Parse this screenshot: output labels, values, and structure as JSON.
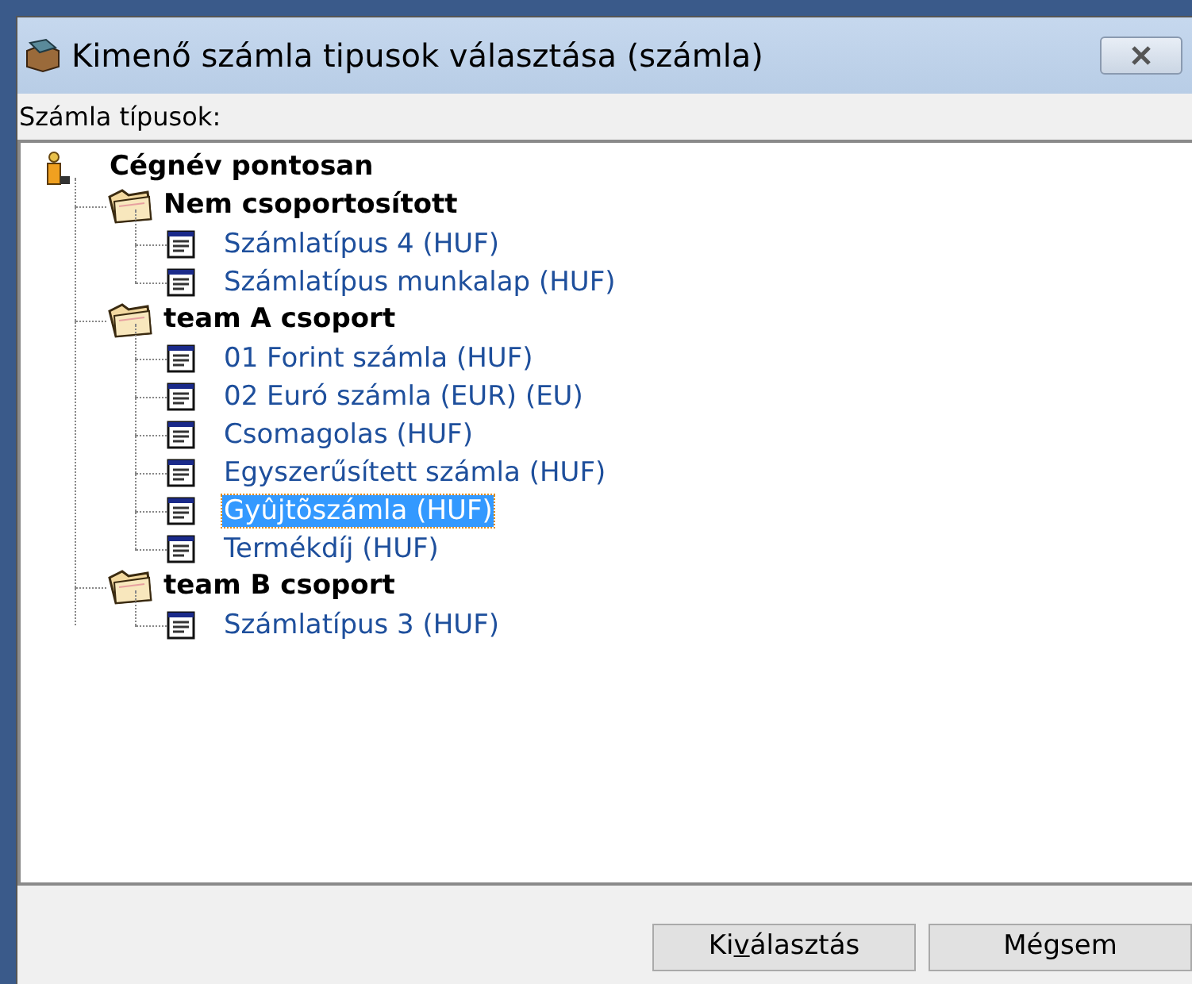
{
  "window": {
    "title": "Kimenő számla tipusok választása (számla)"
  },
  "tree_label": "Számla típusok:",
  "tree": {
    "label": "Cégnév pontosan",
    "children": [
      {
        "label": "Nem csoportosított",
        "children": [
          {
            "label": "Számlatípus 4 (HUF)",
            "selected": false
          },
          {
            "label": "Számlatípus munkalap (HUF)",
            "selected": false
          }
        ]
      },
      {
        "label": "team A csoport",
        "children": [
          {
            "label": "01 Forint számla (HUF)",
            "selected": false
          },
          {
            "label": "02 Euró számla (EUR) (EU)",
            "selected": false
          },
          {
            "label": "Csomagolas (HUF)",
            "selected": false
          },
          {
            "label": "Egyszerűsített számla (HUF)",
            "selected": false
          },
          {
            "label": "Gyûjtõszámla (HUF)",
            "selected": true
          },
          {
            "label": "Termékdíj (HUF)",
            "selected": false
          }
        ]
      },
      {
        "label": "team B csoport",
        "children": [
          {
            "label": "Számlatípus 3 (HUF)",
            "selected": false
          }
        ]
      }
    ]
  },
  "buttons": [
    {
      "label": "Kiválasztás",
      "access_key_underlined": true
    },
    {
      "label": "Mégsem",
      "access_key_underlined": false
    }
  ]
}
